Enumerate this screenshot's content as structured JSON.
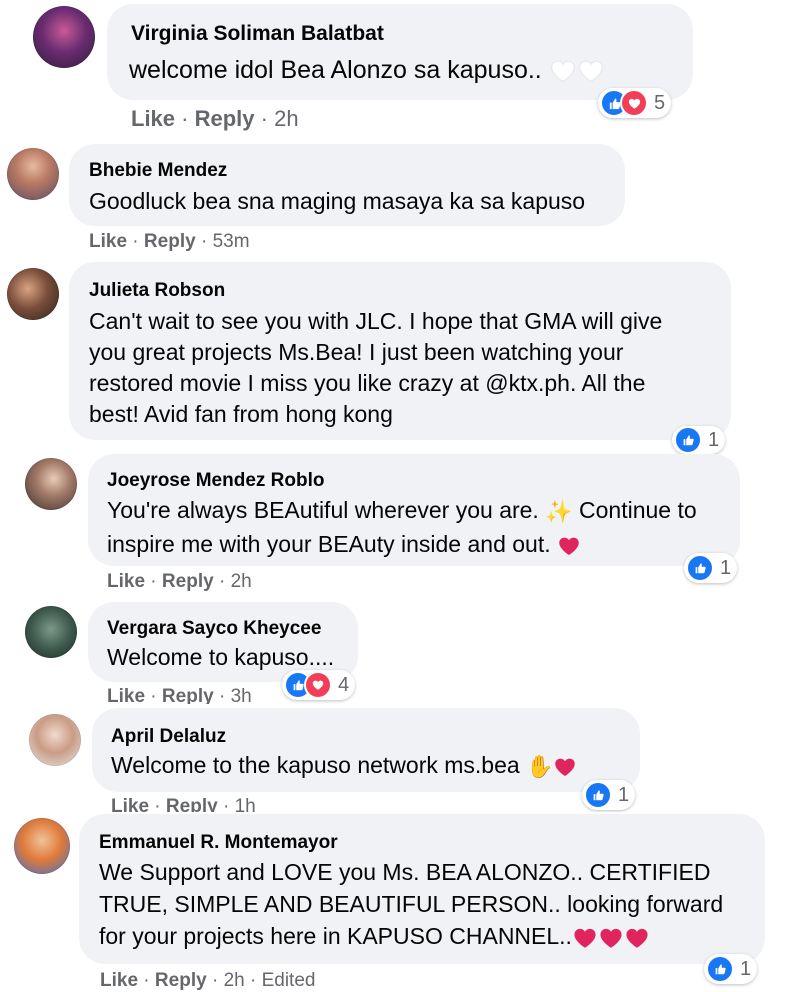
{
  "comments": [
    {
      "author": "Virginia Soliman Balatbat",
      "lines": [
        "welcome idol Bea Alonzo sa kapuso.."
      ],
      "like_label": "Like",
      "reply_label": "Reply",
      "time": "2h",
      "reaction_count": "5"
    },
    {
      "author": "Bhebie Mendez",
      "lines": [
        "Goodluck bea sna maging masaya ka sa kapuso"
      ],
      "like_label": "Like",
      "reply_label": "Reply",
      "time": "53m"
    },
    {
      "author": "Julieta Robson",
      "lines": [
        "Can't wait to see you with JLC. I hope that GMA will give",
        "you great projects Ms.Bea! I just been watching your",
        "restored movie I miss you like crazy at @ktx.ph. All the",
        "best! Avid fan from hong kong"
      ],
      "reaction_count": "1"
    },
    {
      "author": "Joeyrose Mendez Roblo",
      "lines": [
        "You're always BEAutiful wherever you are.",
        "Continue to",
        "inspire me with your BEAuty inside and out."
      ],
      "like_label": "Like",
      "reply_label": "Reply",
      "time": "2h",
      "reaction_count": "1"
    },
    {
      "author": "Vergara Sayco Kheycee",
      "lines": [
        "Welcome to kapuso...."
      ],
      "like_label": "Like",
      "reply_label": "Reply",
      "time": "3h",
      "reaction_count": "4"
    },
    {
      "author": "April Delaluz",
      "lines": [
        "Welcome to the kapuso network ms.bea"
      ],
      "like_label": "Like",
      "reply_label": "Reply",
      "time": "1h",
      "reaction_count": "1"
    },
    {
      "author": "Emmanuel R. Montemayor",
      "lines": [
        "We Support and LOVE you Ms. BEA ALONZO.. CERTIFIED",
        "TRUE, SIMPLE AND BEAUTIFUL PERSON.. looking forward",
        "for your projects here in KAPUSO CHANNEL.."
      ],
      "like_label": "Like",
      "reply_label": "Reply",
      "time": "2h",
      "edited_label": "Edited",
      "reaction_count": "1"
    }
  ],
  "colors": {
    "bubble": "#f0f2f5",
    "meta_text": "#65676b",
    "like_blue": "#1877f2",
    "love_red": "#f33e58",
    "heart_red": "#e0245e"
  }
}
